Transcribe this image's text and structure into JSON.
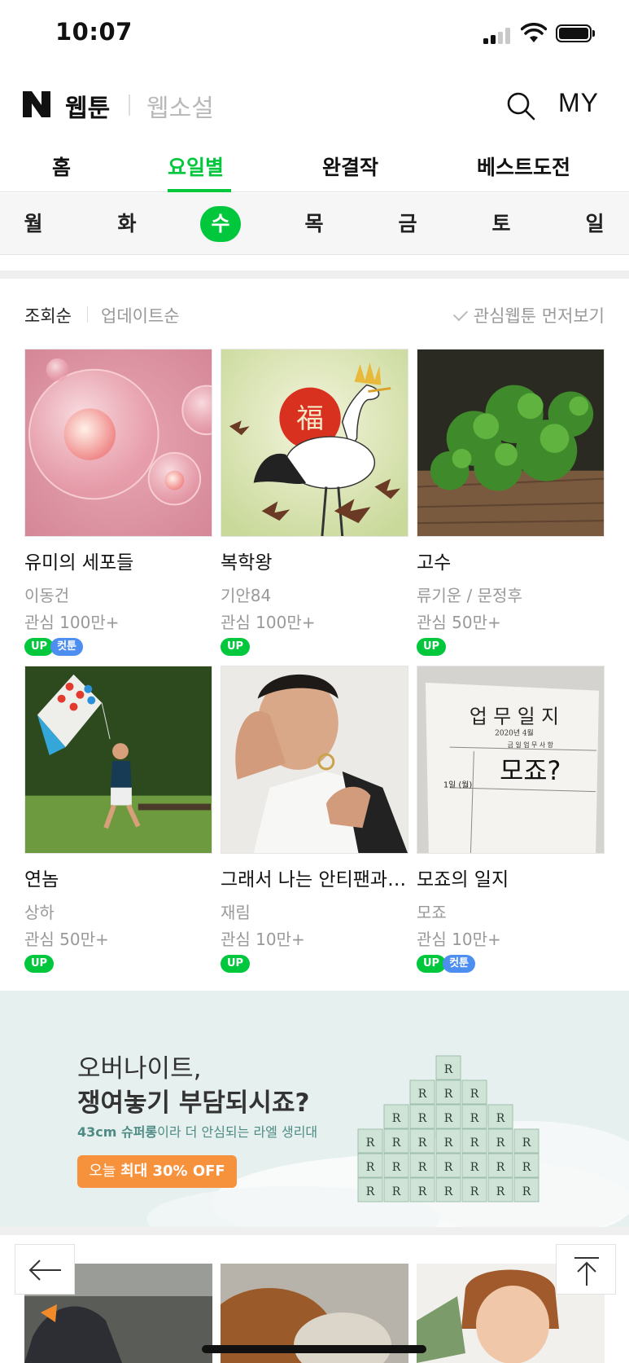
{
  "status": {
    "time": "10:07"
  },
  "header": {
    "title": "웹툰",
    "alt": "웹소설",
    "my": "MY"
  },
  "main_tabs": [
    {
      "label": "홈"
    },
    {
      "label": "요일별",
      "active": true
    },
    {
      "label": "완결작"
    },
    {
      "label": "베스트도전"
    }
  ],
  "days": [
    "월",
    "화",
    "수",
    "목",
    "금",
    "토",
    "일"
  ],
  "active_day": "수",
  "sort": {
    "views": "조회순",
    "updated": "업데이트순",
    "fav_first": "관심웹툰 먼저보기"
  },
  "webtoons": [
    {
      "title": "유미의 세포들",
      "author": "이동건",
      "fav": "관심 100만+",
      "badges": [
        "UP",
        "컷툰"
      ],
      "thumb": "cells"
    },
    {
      "title": "복학왕",
      "author": "기안84",
      "fav": "관심 100만+",
      "badges": [
        "UP"
      ],
      "thumb": "crane"
    },
    {
      "title": "고수",
      "author": "류기운 / 문정후",
      "fav": "관심 50만+",
      "badges": [
        "UP"
      ],
      "thumb": "coriander"
    },
    {
      "title": "연놈",
      "author": "상하",
      "fav": "관심 50만+",
      "badges": [
        "UP"
      ],
      "thumb": "kite"
    },
    {
      "title": "그래서 나는 안티팬과 결혼했다",
      "author": "재림",
      "fav": "관심 10만+",
      "badges": [
        "UP"
      ],
      "thumb": "man"
    },
    {
      "title": "모죠의 일지",
      "author": "모죠",
      "fav": "관심 10만+",
      "badges": [
        "UP",
        "컷툰"
      ],
      "thumb": "diary"
    }
  ],
  "diary_text": {
    "title": "업 무 일 지",
    "date": "2020년 4월",
    "sub": "금 일 업 무 사 항",
    "day": "1일 (월)",
    "body": "모죠?"
  },
  "ad": {
    "line1": "오버나이트,",
    "line2": "쟁여놓기 부담되시죠?",
    "line3_highlight": "43cm 슈퍼롱",
    "line3_rest": "이라 더 안심되는 라엘 생리대",
    "cta_prefix": "오늘 ",
    "cta_bold": "최대 30% OFF",
    "product_letter": "R"
  },
  "colors": {
    "accent": "#00c73c",
    "cut_badge": "#4d8ff0",
    "ad_cta": "#f7923c"
  },
  "icons": [
    "search-icon",
    "back-arrow-icon",
    "scroll-top-icon",
    "wifi-icon",
    "battery-icon",
    "signal-icon"
  ]
}
